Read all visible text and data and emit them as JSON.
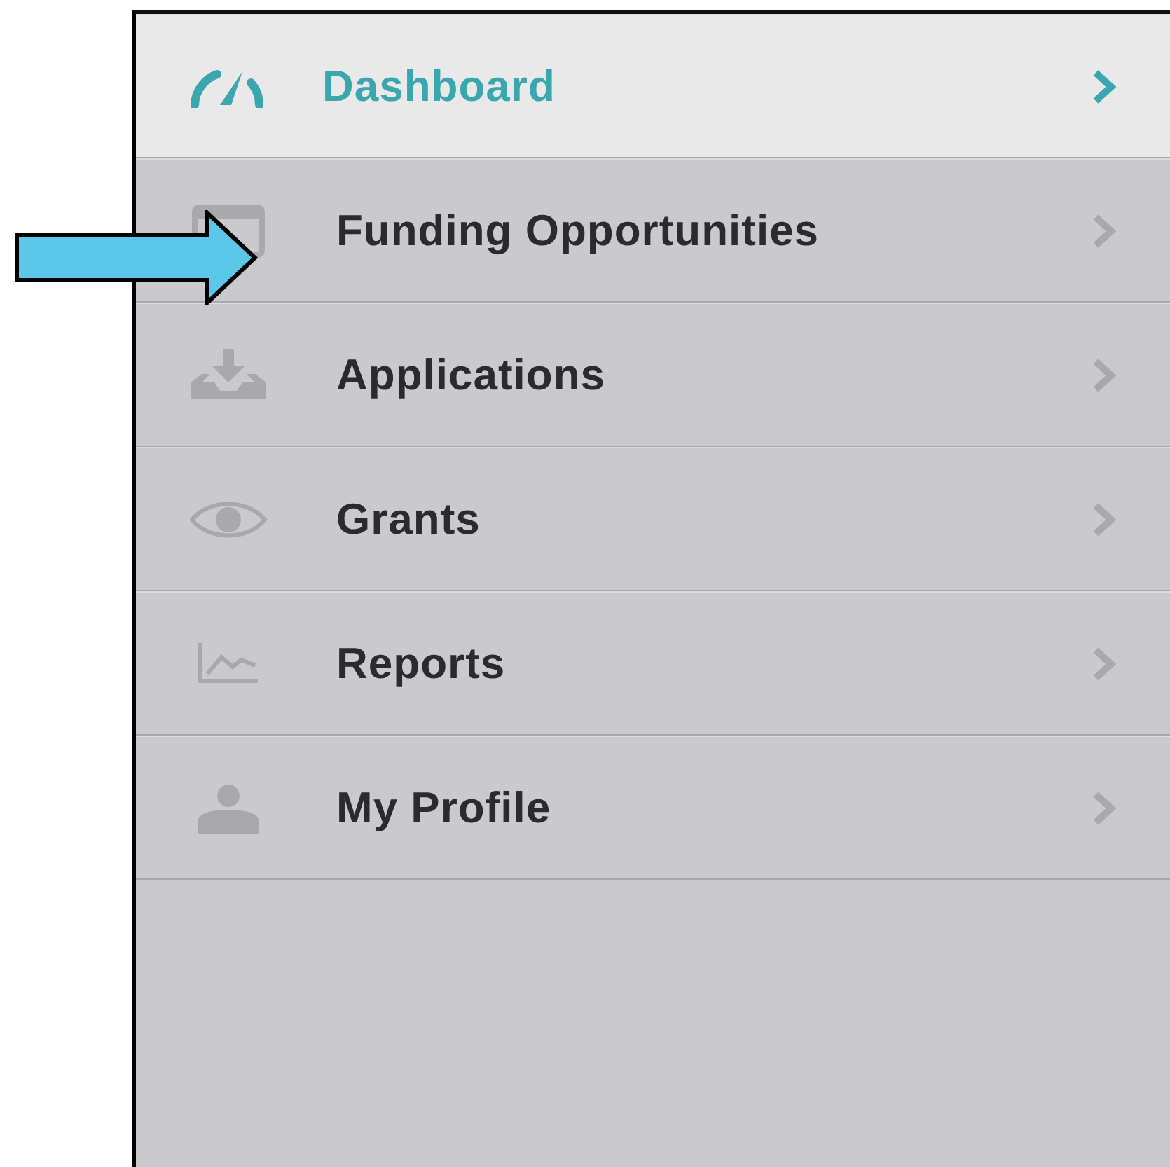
{
  "menu": {
    "items": [
      {
        "label": "Dashboard",
        "selected": true
      },
      {
        "label": "Funding Opportunities",
        "selected": false
      },
      {
        "label": "Applications",
        "selected": false
      },
      {
        "label": "Grants",
        "selected": false
      },
      {
        "label": "Reports",
        "selected": false
      },
      {
        "label": "My Profile",
        "selected": false
      }
    ]
  }
}
